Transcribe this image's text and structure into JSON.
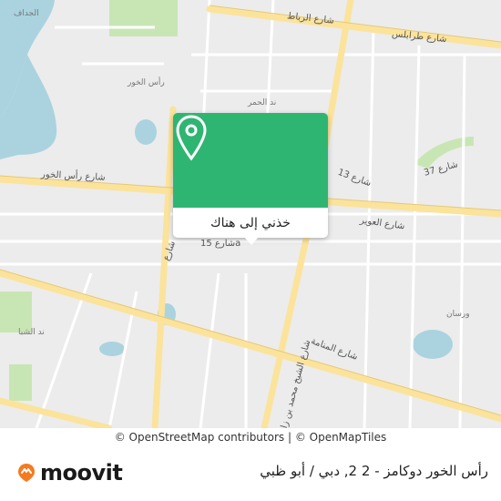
{
  "map": {
    "road_labels": [
      "شارع الرباط",
      "شارع طرابلس",
      "شارع 13",
      "شارع 37",
      "شارع رأس الخور",
      "شارع العوير",
      "شارع 15a",
      "شارع المنامة",
      "شارع الشيخ محمد بن زايد",
      "شارع"
    ],
    "area_labels": [
      "الجداف",
      "رأس الخور",
      "ند الحمر",
      "ورسان",
      "ند الشبا"
    ],
    "colors": {
      "background": "#ececec",
      "water": "#aad3df",
      "park": "#c8e6b4",
      "major_road": "#fbe39b",
      "minor_road": "#ffffff",
      "accent": "#2fb572"
    }
  },
  "popup": {
    "pin_icon": "map-pin-icon",
    "action_label": "خذني إلى هناك"
  },
  "attribution": {
    "text": "© OpenStreetMap contributors | © OpenMapTiles"
  },
  "footer": {
    "brand": "moovit",
    "destination": "رأس الخور دوكامز - 2 2, دبي / أبو ظبي"
  }
}
